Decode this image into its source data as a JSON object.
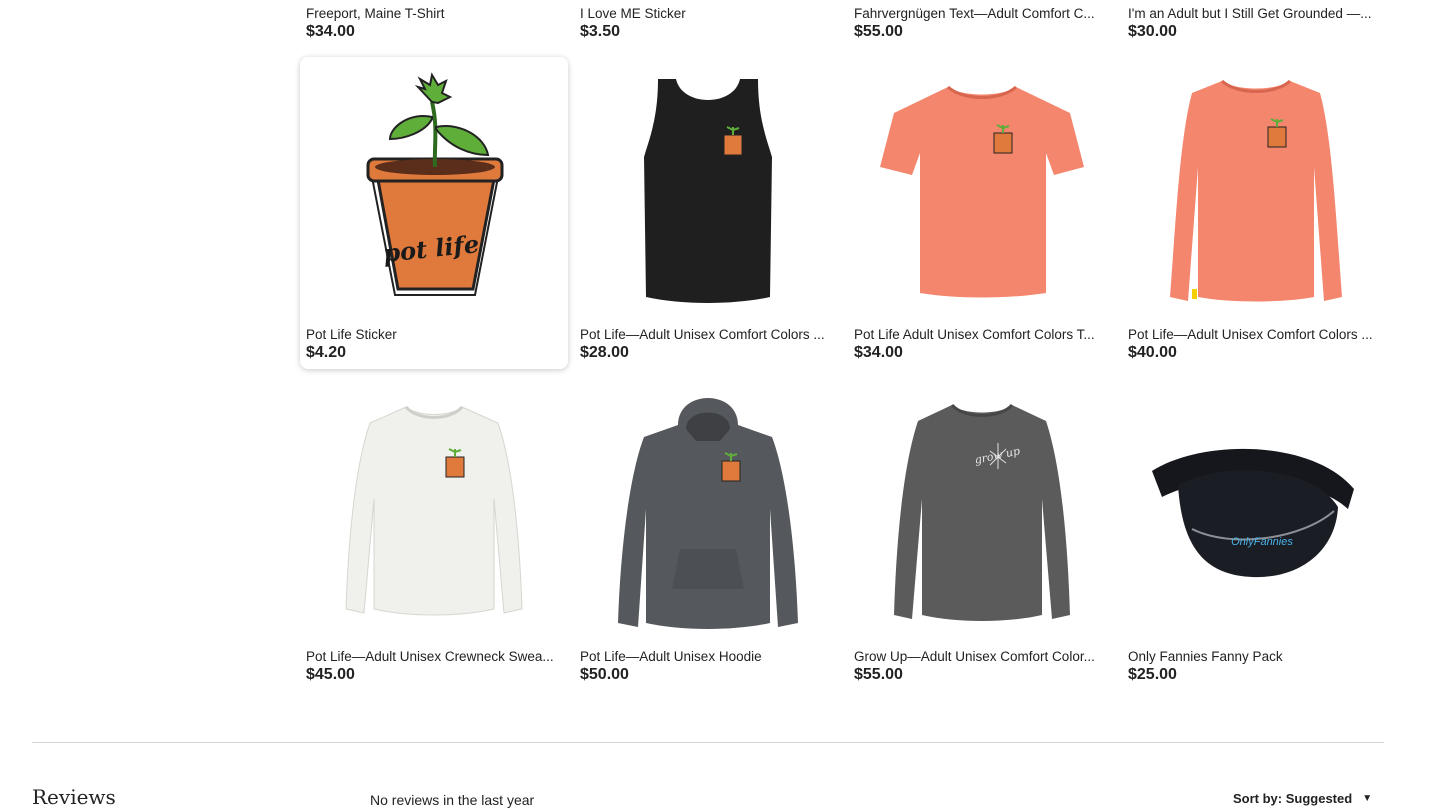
{
  "top_row": [
    {
      "title": "Freeport, Maine T-Shirt",
      "price": "$34.00"
    },
    {
      "title": "I Love ME Sticker",
      "price": "$3.50"
    },
    {
      "title": "Fahrvergnügen Text—Adult Comfort C...",
      "price": "$55.00"
    },
    {
      "title": "I'm an Adult but I Still Get Grounded —...",
      "price": "$30.00"
    }
  ],
  "row2": [
    {
      "title": "Pot Life Sticker",
      "price": "$4.20",
      "image": "pot-life-sticker"
    },
    {
      "title": "Pot Life—Adult Unisex Comfort Colors ...",
      "price": "$28.00",
      "image": "black-tank-top"
    },
    {
      "title": "Pot Life Adult Unisex Comfort Colors T...",
      "price": "$34.00",
      "image": "coral-t-shirt"
    },
    {
      "title": "Pot Life—Adult Unisex Comfort Colors ...",
      "price": "$40.00",
      "image": "coral-long-sleeve"
    }
  ],
  "row3": [
    {
      "title": "Pot Life—Adult Unisex Crewneck Swea...",
      "price": "$45.00",
      "image": "white-crewneck"
    },
    {
      "title": "Pot Life—Adult Unisex Hoodie",
      "price": "$50.00",
      "image": "grey-hoodie"
    },
    {
      "title": "Grow Up—Adult Unisex Comfort Color...",
      "price": "$55.00",
      "image": "grey-sweatshirt"
    },
    {
      "title": "Only Fannies Fanny Pack",
      "price": "$25.00",
      "image": "fanny-pack"
    }
  ],
  "images": {
    "sticker_text": "pot life",
    "sweatshirt_text": "grow up",
    "fanny_pack_text": "OnlyFannies"
  },
  "reviews": {
    "heading": "Reviews",
    "empty_text": "No reviews in the last year",
    "sort_label": "Sort by: Suggested",
    "sort_caret": "▼"
  },
  "colors": {
    "coral": "#f4866e",
    "black_garment": "#1f1f1f",
    "grey_hoodie": "#55585c",
    "grey_sweatshirt": "#5b5b5b",
    "white_garment": "#f0f0ec",
    "pot_orange": "#e07a3c"
  }
}
